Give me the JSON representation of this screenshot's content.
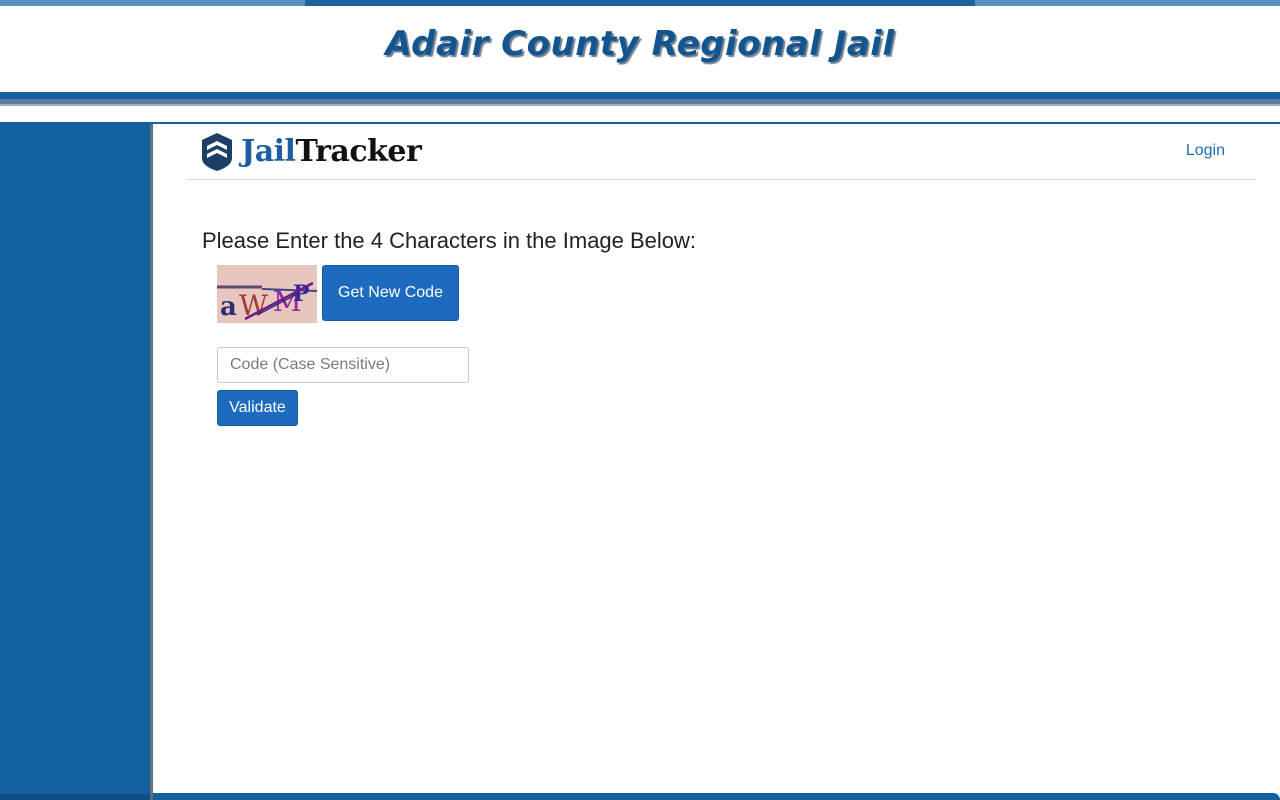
{
  "banner": {
    "title": "Adair County Regional Jail"
  },
  "navbar": {
    "brand_jail": "Jail",
    "brand_tracker": "Tracker",
    "login_label": "Login"
  },
  "captcha": {
    "prompt": "Please Enter the 4 Characters in the Image Below:",
    "image_text": "aWMP",
    "new_code_label": "Get New Code",
    "input_placeholder": "Code (Case Sensitive)",
    "input_value": "",
    "validate_label": "Validate"
  },
  "colors": {
    "primary_blue": "#12609e",
    "button_blue": "#1c6bbf",
    "link_blue": "#1e6bb8"
  }
}
